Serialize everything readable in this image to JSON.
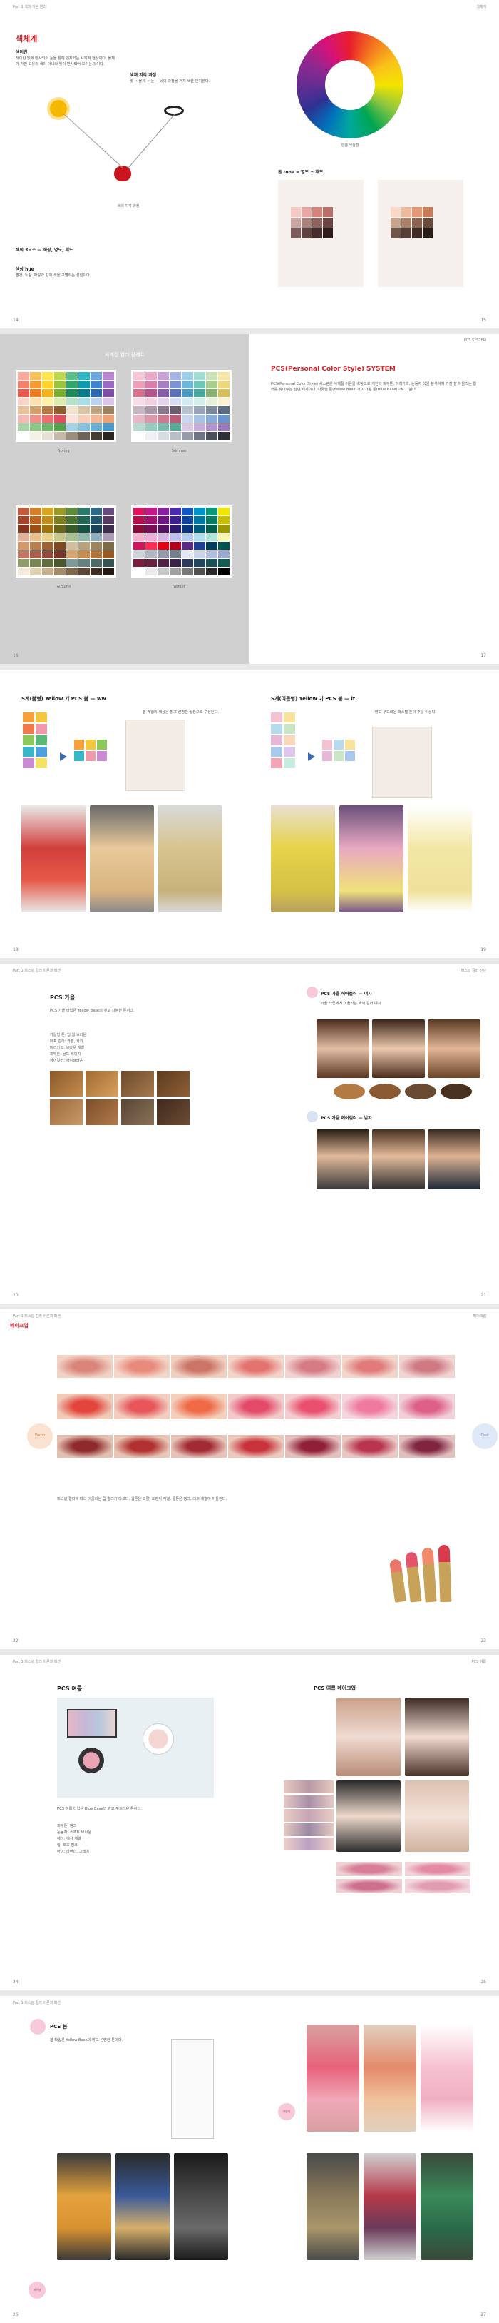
{
  "spreads": [
    {
      "left": {
        "header": "Part 1 색의 기본 원리",
        "section_title": "색체계",
        "subhead_1": "색이란",
        "text_1": "색이란 빛에 반사되어 눈을 통해 인지되는 시각적 현상이다. 물체가 가진 고유의 색이 아니라 빛이 반사되어 보이는 것이다.",
        "subhead_2": "색채 지각 과정",
        "text_2": "빛 → 물체 → 눈 → 뇌의 과정을 거쳐 색을 인지한다.",
        "diagram_caption": "색의 지각 과정",
        "subhead_3": "색의 3요소 — 색상, 명도, 채도",
        "subhead_4": "색상 hue",
        "text_4": "빨강, 노랑, 파랑과 같이 색을 구별하는 성질이다.",
        "page_number": "14"
      },
      "right": {
        "header": "색체계",
        "wheel_caption": "먼셀 색상환",
        "subhead": "톤 tone = 명도 + 채도",
        "page_number": "15"
      }
    },
    {
      "left": {
        "title": "사계절 컬러 팔레트",
        "labels": [
          "Spring",
          "Summer",
          "Autumn",
          "Winter"
        ],
        "page_number": "16"
      },
      "right": {
        "header": "PCS SYSTEM",
        "title": "PCS(Personal Color Style) SYSTEM",
        "text": "PCS(Personal Color Style) 시스템은 사계절 이론을 바탕으로 개인의 피부톤, 머리카락, 눈동자 색을 분석하여 가장 잘 어울리는 컬러를 찾아주는 진단 체계이다. 따뜻한 톤(Yellow Base)과 차가운 톤(Blue Base)으로 나뉜다.",
        "page_number": "17"
      }
    },
    {
      "left": {
        "title": "S계(봄형) Yellow 기 PCS 봄 — ww",
        "text": "봄 계열의 색상은 밝고 선명한 웜톤으로 구성된다.",
        "page_number": "18"
      },
      "right": {
        "title": "S계(여름형) Yellow 기 PCS 봄 — lt",
        "text": "밝고 부드러운 파스텔 톤이 주를 이룬다.",
        "page_number": "19"
      }
    },
    {
      "left": {
        "header": "Part 1 퍼스널 컬러 이론과 패션",
        "title": "PCS 가을",
        "text": "PCS 가을 타입은 Yellow Base의 깊고 차분한 톤이다.",
        "list": [
          "가을형 톤: 딥 웜 브라운",
          "대표 컬러: 카멜, 카키",
          "머리카락: 브라운 계열",
          "피부톤: 골드 베이지",
          "헤어컬러: 애쉬브라운"
        ],
        "page_number": "20"
      },
      "right": {
        "header": "퍼스널 컬러 진단",
        "title_1": "PCS 가을 헤어컬러 — 여자",
        "text_1": "가을 타입에게 어울리는 헤어 컬러 예시",
        "title_2": "PCS 가을 헤어컬러 — 남자",
        "page_number": "21"
      }
    },
    {
      "left": {
        "header": "Part 1 퍼스널 컬러 이론과 패션",
        "title": "메이크업",
        "warm": "Warm",
        "text": "퍼스널 컬러에 따라 어울리는 립 컬러가 다르다. 웜톤은 코랄, 오렌지 계열, 쿨톤은 핑크, 레드 계열이 어울린다.",
        "page_number": "22"
      },
      "right": {
        "header": "메이크업",
        "cool": "Cool",
        "page_number": "23"
      }
    },
    {
      "left": {
        "header": "Part 1 퍼스널 컬러 이론과 패션",
        "title": "PCS 여름",
        "text": "PCS 여름 타입은 Blue Base의 밝고 부드러운 톤이다.",
        "list": [
          "피부톤: 핑크",
          "눈동자: 소프트 브라운",
          "헤어: 애쉬 계열",
          "립: 로즈 핑크",
          "아이: 라벤더, 그레이"
        ],
        "page_number": "24"
      },
      "right": {
        "header": "PCS 여름",
        "title": "PCS 여름 메이크업",
        "page_number": "25"
      }
    },
    {
      "left": {
        "header": "Part 1 퍼스널 컬러 이론과 패션",
        "title": "PCS 봄",
        "text": "봄 타입은 Yellow Base의 밝고 선명한 톤이다.",
        "badge": "퍼스널",
        "page_number": "26"
      },
      "right": {
        "badge": "여름형",
        "page_number": "27"
      }
    }
  ],
  "colors": {
    "accent": "#d7252b",
    "pink": "#f7c9da",
    "gray_panel": "#d0d0d0"
  }
}
